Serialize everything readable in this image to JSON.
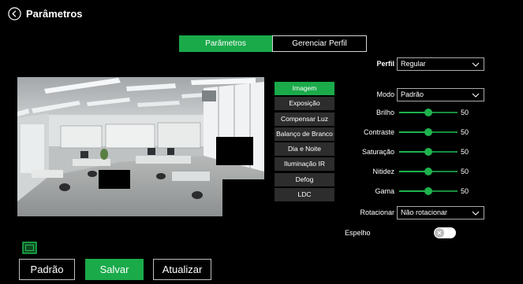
{
  "header": {
    "title": "Parâmetros",
    "back_icon": "back-arrow-icon"
  },
  "tabs": [
    {
      "label": "Parâmetros",
      "active": true
    },
    {
      "label": "Gerenciar Perfil",
      "active": false
    }
  ],
  "preview": {
    "view_icon": "fit-view-icon"
  },
  "menu": {
    "items": [
      {
        "label": "Imagem",
        "active": true
      },
      {
        "label": "Exposição",
        "active": false
      },
      {
        "label": "Compensar Luz",
        "active": false
      },
      {
        "label": "Balanço de Branco",
        "active": false
      },
      {
        "label": "Dia e Noite",
        "active": false
      },
      {
        "label": "Iluminação IR",
        "active": false
      },
      {
        "label": "Defog",
        "active": false
      },
      {
        "label": "LDC",
        "active": false
      }
    ]
  },
  "settings": {
    "profile": {
      "label": "Perfil",
      "value": "Regular"
    },
    "mode": {
      "label": "Modo",
      "value": "Padrão"
    },
    "sliders": [
      {
        "label": "Brilho",
        "value": 50
      },
      {
        "label": "Contraste",
        "value": 50
      },
      {
        "label": "Saturação",
        "value": 50
      },
      {
        "label": "Nitidez",
        "value": 50
      },
      {
        "label": "Gama",
        "value": 50
      }
    ],
    "rotate": {
      "label": "Rotacionar",
      "value": "Não rotacionar"
    },
    "mirror": {
      "label": "Espelho",
      "enabled": false
    }
  },
  "buttons": {
    "default": "Padrão",
    "save": "Salvar",
    "refresh": "Atualizar"
  },
  "colors": {
    "accent": "#1aaa4a",
    "background": "#000000",
    "menu_item": "#2d2d2d",
    "text": "#ffffff"
  },
  "icons": {
    "select_arrow": "chevron-down-icon",
    "mirror_toggle_knob": "close-icon"
  }
}
